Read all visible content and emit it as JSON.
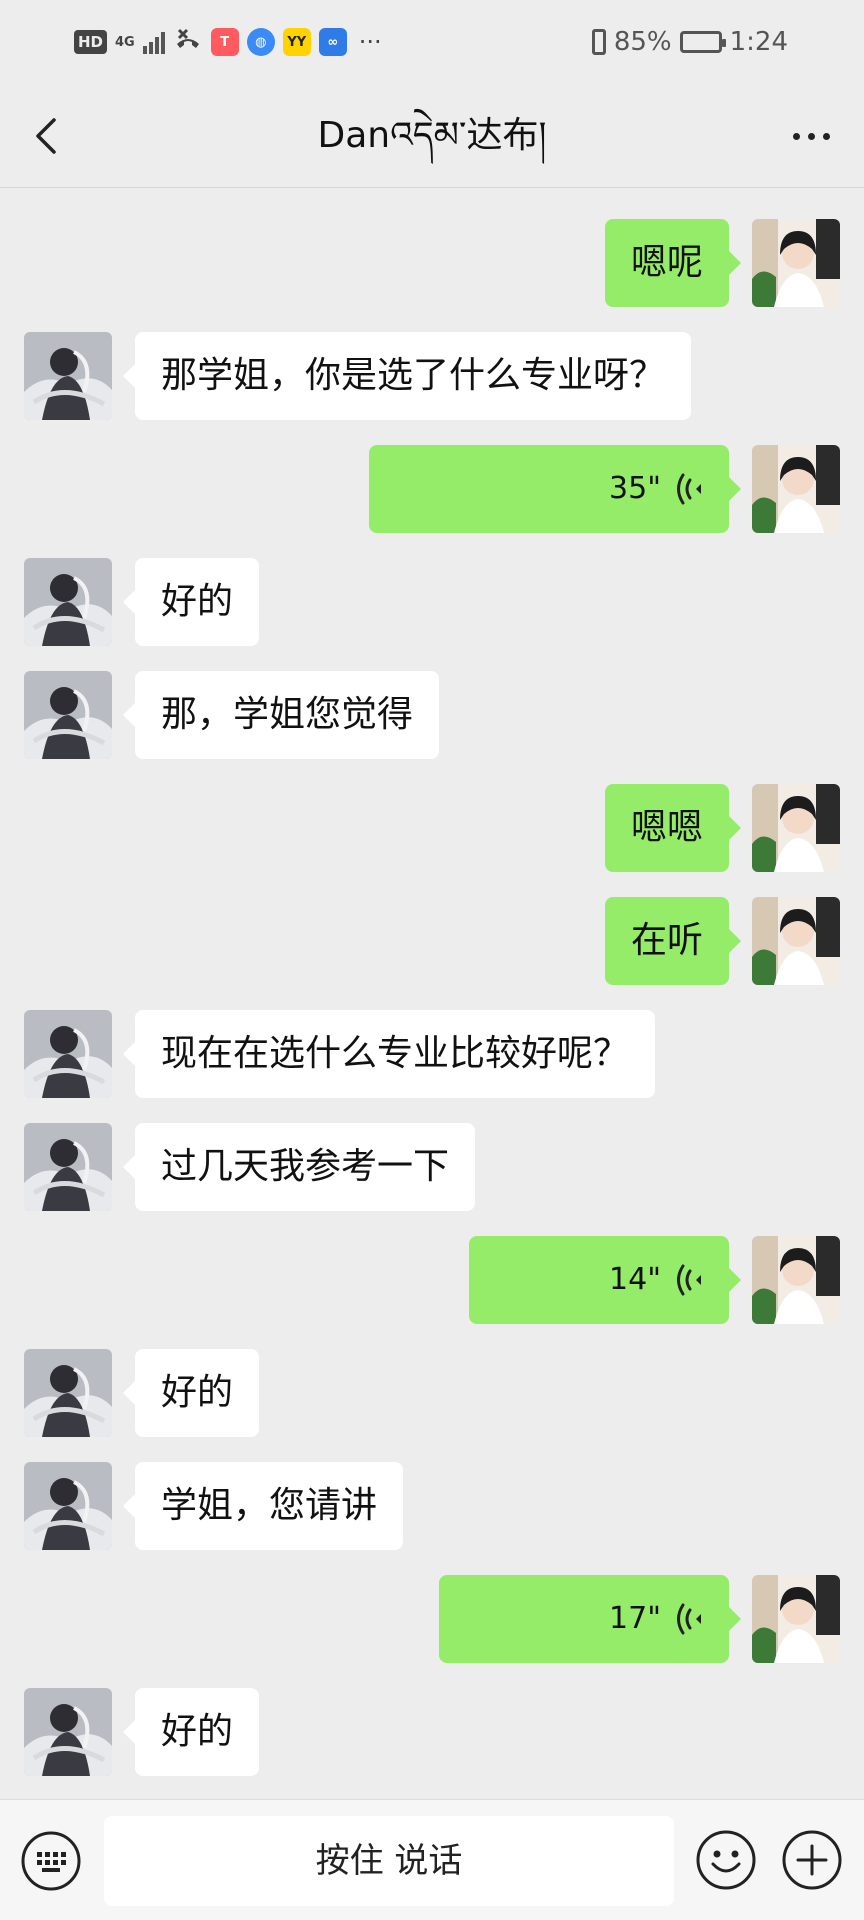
{
  "status_bar": {
    "hd": "HD",
    "network": "4G",
    "battery_percent": "85%",
    "battery_level": 0.85,
    "time": "1:24",
    "app_icons": [
      {
        "name": "missed-call-icon",
        "color": "#444444"
      },
      {
        "name": "app-icon-1",
        "color": "#ff5a5f"
      },
      {
        "name": "app-icon-2",
        "color": "#3a8bf5"
      },
      {
        "name": "yy-icon",
        "color": "#ffd200"
      },
      {
        "name": "app-icon-3",
        "color": "#2f7ce8"
      }
    ],
    "overflow_dots": "···"
  },
  "header": {
    "title": "Danའདེམ་达布།",
    "back_icon": "chevron-left-icon",
    "more_icon": "more-icon"
  },
  "messages": [
    {
      "sender": "me",
      "type": "text",
      "text": "嗯呢"
    },
    {
      "sender": "other",
      "type": "text",
      "text": "那学姐，你是选了什么专业呀？"
    },
    {
      "sender": "me",
      "type": "voice",
      "duration": "35\""
    },
    {
      "sender": "other",
      "type": "text",
      "text": "好的"
    },
    {
      "sender": "other",
      "type": "text",
      "text": "那，学姐您觉得"
    },
    {
      "sender": "me",
      "type": "text",
      "text": "嗯嗯"
    },
    {
      "sender": "me",
      "type": "text",
      "text": "在听"
    },
    {
      "sender": "other",
      "type": "text",
      "text": "现在在选什么专业比较好呢？"
    },
    {
      "sender": "other",
      "type": "text",
      "text": "过几天我参考一下"
    },
    {
      "sender": "me",
      "type": "voice",
      "duration": "14\""
    },
    {
      "sender": "other",
      "type": "text",
      "text": "好的"
    },
    {
      "sender": "other",
      "type": "text",
      "text": "学姐，您请讲"
    },
    {
      "sender": "me",
      "type": "voice",
      "duration": "17\""
    },
    {
      "sender": "other",
      "type": "text",
      "text": "好的"
    }
  ],
  "bottom_bar": {
    "hold_to_talk": "按住 说话",
    "keyboard_icon": "keyboard-icon",
    "emoji_icon": "emoji-icon",
    "plus_icon": "plus-icon"
  },
  "colors": {
    "background": "#ededed",
    "my_bubble": "#95ec69",
    "their_bubble": "#ffffff"
  }
}
